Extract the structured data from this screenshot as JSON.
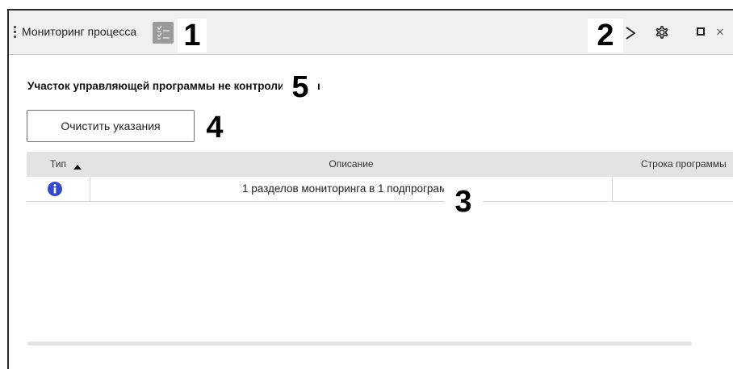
{
  "window": {
    "title": "Мониторинг процесса"
  },
  "titlebar_icons": {
    "list": "checklist-icon",
    "run": "play-icon",
    "settings": "gear-icon",
    "maximize": "maximize-icon",
    "close": "close-icon",
    "close_glyph": "×"
  },
  "content": {
    "status_message": "Участок управляющей программы не контролируется",
    "clear_button_label": "Очистить указания"
  },
  "table": {
    "columns": [
      "Тип",
      "Описание",
      "Строка программы"
    ],
    "sorted_column": "Тип",
    "sort_direction": "ascending",
    "rows": [
      {
        "type_icon": "info-icon",
        "description": "1 разделов мониторинга в 1 подпрограмме",
        "program_line": ""
      }
    ]
  },
  "callouts": [
    "1",
    "2",
    "3",
    "4",
    "5"
  ],
  "colors": {
    "info_icon": "#3549c9",
    "header_bg": "#e3e3e3",
    "titlebar_bg": "#f0f0f0",
    "active_icon_bg": "#9a9a9a"
  }
}
